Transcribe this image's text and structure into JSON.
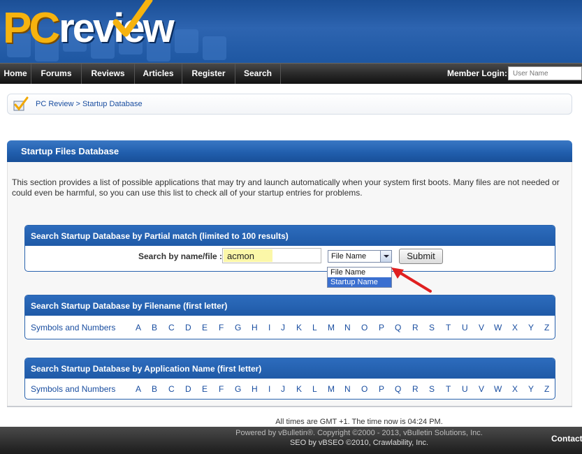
{
  "header": {
    "logo_pc": "PC",
    "logo_rest": "review"
  },
  "nav": {
    "items": [
      "Home",
      "Forums",
      "Reviews",
      "Articles",
      "Register",
      "Search"
    ],
    "login_label": "Member Login:",
    "username_placeholder": "User Name"
  },
  "breadcrumb": {
    "root": "PC Review",
    "separator": " > ",
    "current": "Startup Database"
  },
  "panel": {
    "title": "Startup Files Database",
    "intro": "This section provides a list of possible applications that may try and launch automatically when your system first boots. Many files are not needed or could even be harmful, so you can use this list to check all of your startup entries for problems."
  },
  "search": {
    "heading": "Search Startup Database by Partial match (limited to 100 results)",
    "label": "Search by name/file :",
    "value": "acmon",
    "select_value": "File Name",
    "options": [
      "File Name",
      "Startup Name"
    ],
    "highlighted_option": "Startup Name",
    "submit_label": "Submit"
  },
  "by_filename": {
    "heading": "Search Startup Database by Filename (first letter)"
  },
  "by_appname": {
    "heading": "Search Startup Database by Application Name (first letter)"
  },
  "letters": [
    "Symbols and Numbers",
    "A",
    "B",
    "C",
    "D",
    "E",
    "F",
    "G",
    "H",
    "I",
    "J",
    "K",
    "L",
    "M",
    "N",
    "O",
    "P",
    "Q",
    "R",
    "S",
    "T",
    "U",
    "V",
    "W",
    "X",
    "Y",
    "Z"
  ],
  "footer": {
    "time": "All times are GMT +1. The time now is 04:24 PM.",
    "powered": "Powered by vBulletin®. Copyright ©2000 - 2013, vBulletin Solutions, Inc.",
    "seo": "SEO by vBSEO ©2010, Crawlability, Inc.",
    "contact": "Contact"
  },
  "colors": {
    "header_blue": "#1e57a2",
    "logo_orange": "#f6b30f",
    "link_blue": "#1a4ea0",
    "arrow_red": "#e02020",
    "highlight_yellow": "#fbf7a8"
  }
}
